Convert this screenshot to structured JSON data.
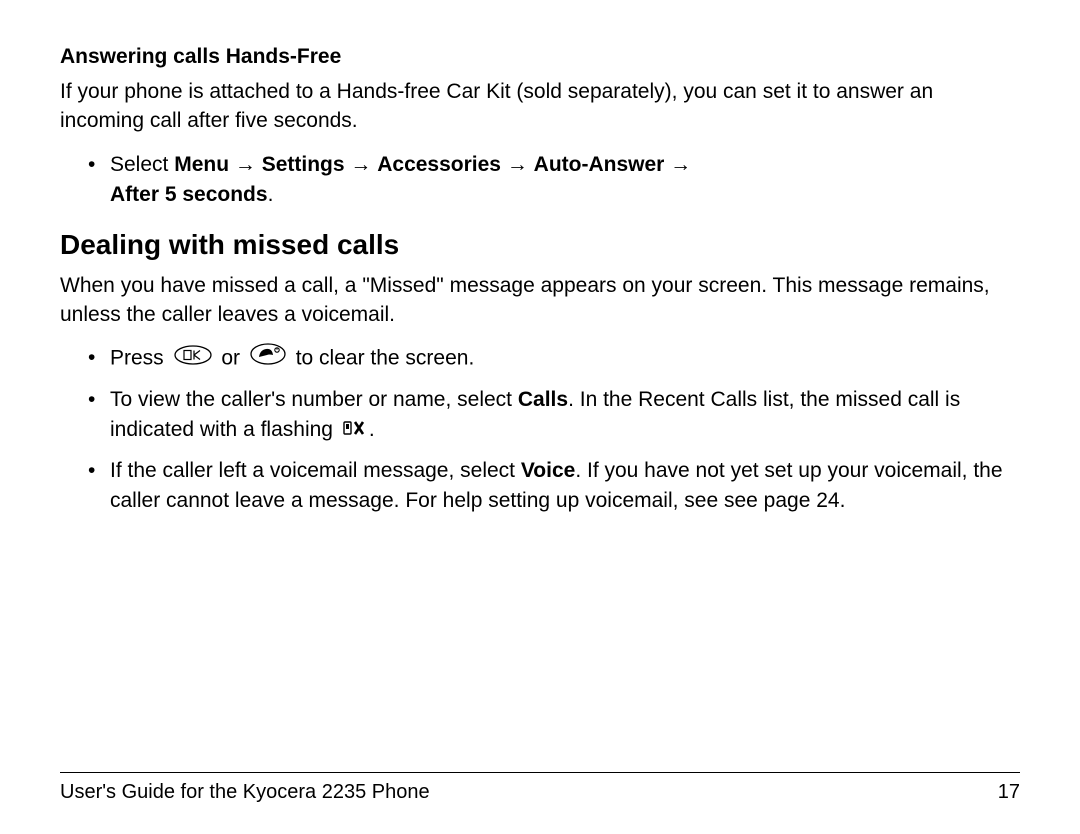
{
  "section1": {
    "heading": "Answering calls Hands-Free",
    "paragraph": "If your phone is attached to a Hands-free Car Kit (sold separately), you can set it to answer an incoming call after five seconds.",
    "bullet1": {
      "prefix": "Select ",
      "path_parts": [
        "Menu",
        "Settings",
        "Accessories",
        "Auto-Answer",
        "After 5 seconds"
      ],
      "arrow": " → "
    }
  },
  "section2": {
    "heading": "Dealing with missed calls",
    "paragraph": "When you have missed a call, a \"Missed\" message appears on your screen. This message remains, unless the caller leaves a voicemail.",
    "bullets": {
      "b1_prefix": "Press ",
      "b1_mid": " or ",
      "b1_suffix": " to clear the screen.",
      "b2_prefix": "To view the caller's number or name, select ",
      "b2_bold": "Calls",
      "b2_mid": ". In the Recent Calls list, the missed call is indicated with a flashing ",
      "b2_suffix": ".",
      "b3_prefix": "If the caller left a voicemail message, select ",
      "b3_bold": "Voice",
      "b3_suffix": ". If you have not yet set up your voicemail, the caller cannot leave a message. For help setting up voicemail, see see page 24."
    }
  },
  "footer": {
    "left": "User's Guide for the Kyocera 2235 Phone",
    "right": "17"
  },
  "icons": {
    "ok_key": "OK key icon",
    "end_key": "End/Power key icon",
    "missed_call": "Missed call flashing icon"
  }
}
